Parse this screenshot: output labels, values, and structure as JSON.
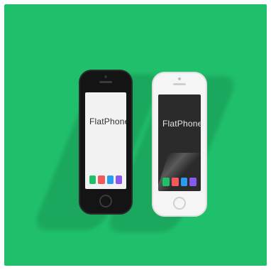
{
  "scene": {
    "background_color": "#1fbf6b",
    "phones": [
      {
        "color": "black",
        "brand_text": "FlatPhone",
        "tagline": "",
        "dock_colors": [
          "#1fbf6b",
          "#f05a5a",
          "#2c9cf0",
          "#8a5af0"
        ]
      },
      {
        "color": "white",
        "brand_text": "FlatPhone",
        "tagline": "",
        "dock_colors": [
          "#1fbf6b",
          "#f05a5a",
          "#2c9cf0",
          "#8a5af0"
        ]
      }
    ]
  }
}
